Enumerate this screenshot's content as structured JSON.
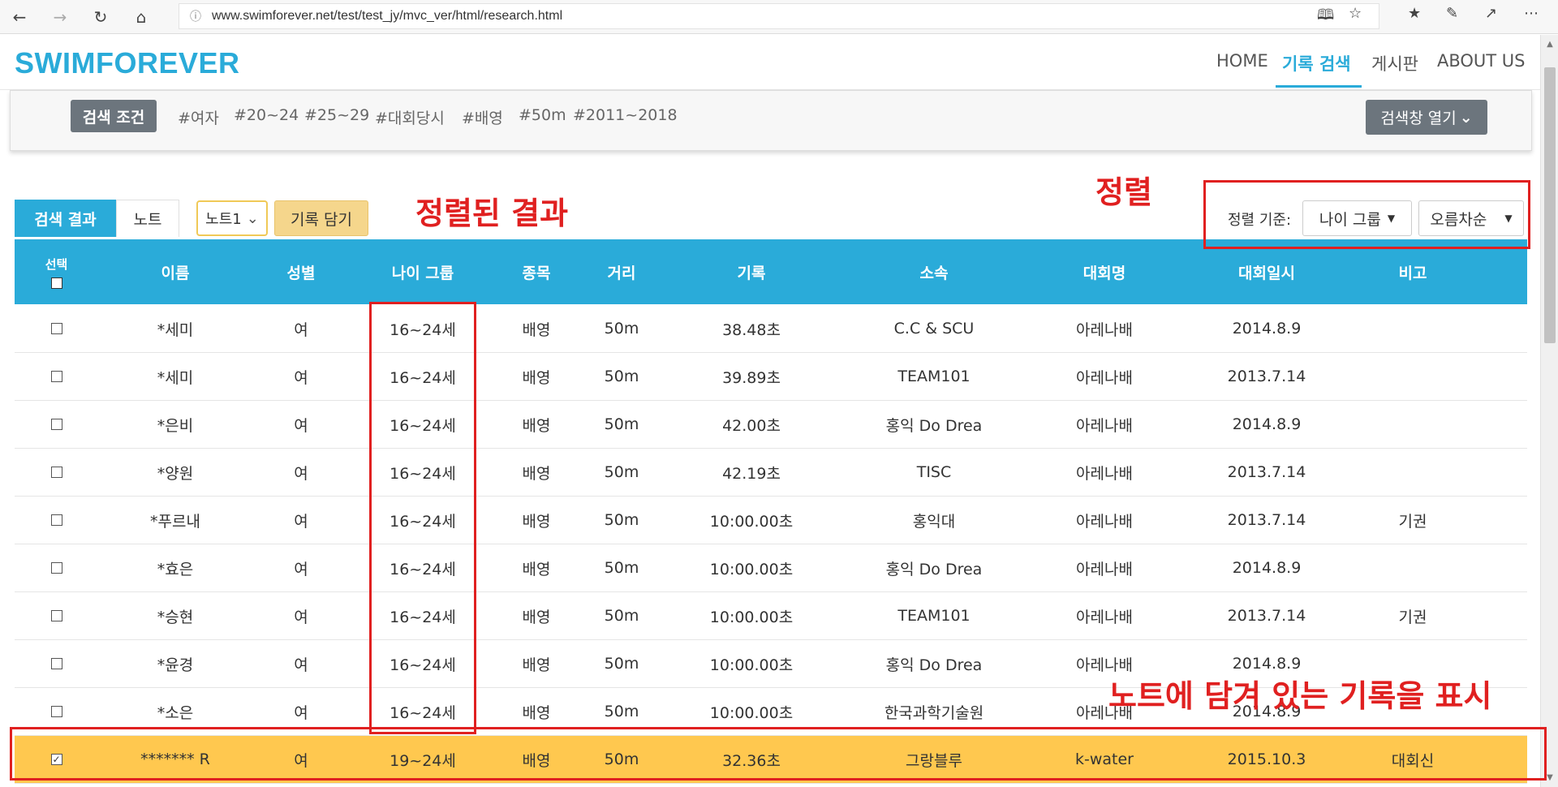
{
  "browser": {
    "url": "www.swimforever.net/test/test_jy/mvc_ver/html/research.html",
    "back_icon": "back-arrow-icon",
    "forward_icon": "forward-arrow-icon",
    "refresh_icon": "refresh-icon",
    "home_icon": "home-icon"
  },
  "header": {
    "brand": "SWIMFOREVER",
    "nav": [
      "HOME",
      "기록 검색",
      "게시판",
      "ABOUT US"
    ],
    "active_nav": "기록 검색",
    "accent_color": "#2aabd9"
  },
  "search_conditions": {
    "label": "검색 조건",
    "tags": [
      "#여자",
      "#20~24",
      "#25~29",
      "#대회당시",
      "#배영",
      "#50m",
      "#2011~2018"
    ],
    "open_button": "검색창 열기"
  },
  "tabs": {
    "results": "검색 결과",
    "note": "노트",
    "note_select": "노트1",
    "add_button": "기록 담기"
  },
  "sort": {
    "label": "정렬 기준:",
    "field": "나이 그룹",
    "order": "오름차순"
  },
  "annotations": {
    "sorted_results": "정렬된 결과",
    "sort": "정렬",
    "note_records": "노트에 담겨 있는 기록을 표시",
    "color": "#e02020"
  },
  "table": {
    "select_header": "선택",
    "columns": [
      "이름",
      "성별",
      "나이 그룹",
      "종목",
      "거리",
      "기록",
      "소속",
      "대회명",
      "대회일시",
      "비고"
    ],
    "rows": [
      {
        "checked": false,
        "name": "*세미",
        "gender": "여",
        "age": "16~24세",
        "event": "배영",
        "distance": "50m",
        "record": "38.48초",
        "team": "C.C & SCU",
        "meet": "아레나배",
        "date": "2014.8.9",
        "note": ""
      },
      {
        "checked": false,
        "name": "*세미",
        "gender": "여",
        "age": "16~24세",
        "event": "배영",
        "distance": "50m",
        "record": "39.89초",
        "team": "TEAM101",
        "meet": "아레나배",
        "date": "2013.7.14",
        "note": ""
      },
      {
        "checked": false,
        "name": "*은비",
        "gender": "여",
        "age": "16~24세",
        "event": "배영",
        "distance": "50m",
        "record": "42.00초",
        "team": "홍익 Do Drea",
        "meet": "아레나배",
        "date": "2014.8.9",
        "note": ""
      },
      {
        "checked": false,
        "name": "*양원",
        "gender": "여",
        "age": "16~24세",
        "event": "배영",
        "distance": "50m",
        "record": "42.19초",
        "team": "TISC",
        "meet": "아레나배",
        "date": "2013.7.14",
        "note": ""
      },
      {
        "checked": false,
        "name": "*푸르내",
        "gender": "여",
        "age": "16~24세",
        "event": "배영",
        "distance": "50m",
        "record": "10:00.00초",
        "team": "홍익대",
        "meet": "아레나배",
        "date": "2013.7.14",
        "note": "기권"
      },
      {
        "checked": false,
        "name": "*효은",
        "gender": "여",
        "age": "16~24세",
        "event": "배영",
        "distance": "50m",
        "record": "10:00.00초",
        "team": "홍익 Do Drea",
        "meet": "아레나배",
        "date": "2014.8.9",
        "note": ""
      },
      {
        "checked": false,
        "name": "*승현",
        "gender": "여",
        "age": "16~24세",
        "event": "배영",
        "distance": "50m",
        "record": "10:00.00초",
        "team": "TEAM101",
        "meet": "아레나배",
        "date": "2013.7.14",
        "note": "기권"
      },
      {
        "checked": false,
        "name": "*윤경",
        "gender": "여",
        "age": "16~24세",
        "event": "배영",
        "distance": "50m",
        "record": "10:00.00초",
        "team": "홍익 Do Drea",
        "meet": "아레나배",
        "date": "2014.8.9",
        "note": ""
      },
      {
        "checked": false,
        "name": "*소은",
        "gender": "여",
        "age": "16~24세",
        "event": "배영",
        "distance": "50m",
        "record": "10:00.00초",
        "team": "한국과학기술원",
        "meet": "아레나배",
        "date": "2014.8.9",
        "note": ""
      },
      {
        "checked": true,
        "name": "******* R",
        "gender": "여",
        "age": "19~24세",
        "event": "배영",
        "distance": "50m",
        "record": "32.36초",
        "team": "그랑블루",
        "meet": "k-water",
        "date": "2015.10.3",
        "note": "대회신"
      }
    ],
    "highlight_color": "#ffc84f"
  }
}
